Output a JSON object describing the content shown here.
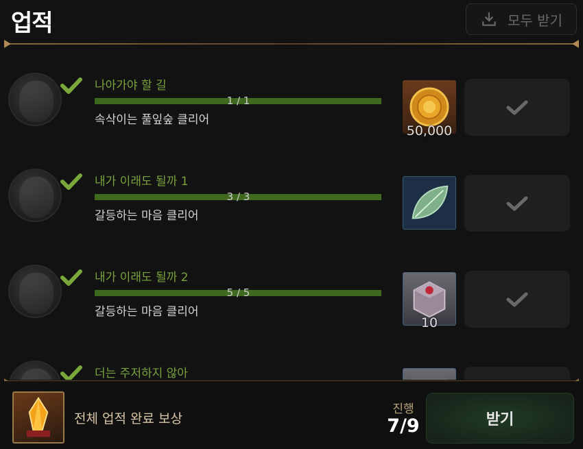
{
  "header": {
    "title": "업적",
    "receive_all_label": "모두 받기"
  },
  "achievements": [
    {
      "title": "나아가야 할 길",
      "progress_text": "1 / 1",
      "progress": 1.0,
      "description": "속삭이는 풀잎숲 클리어",
      "reward_icon": "gold-coin-icon",
      "reward_count": "50,000",
      "status": "claimed"
    },
    {
      "title": "내가 이래도 될까 1",
      "progress_text": "3 / 3",
      "progress": 1.0,
      "description": "갈등하는 마음 클리어",
      "reward_icon": "leaf-icon",
      "reward_count": "",
      "status": "claimed"
    },
    {
      "title": "내가 이래도 될까 2",
      "progress_text": "5 / 5",
      "progress": 1.0,
      "description": "갈등하는 마음 클리어",
      "reward_icon": "treasure-box-icon",
      "reward_count": "10",
      "status": "claimed"
    },
    {
      "title": "더는 주저하지 않아",
      "progress_text": "",
      "progress": 1.0,
      "description": "",
      "reward_icon": "reward-icon",
      "reward_count": "",
      "status": "claimed"
    }
  ],
  "footer": {
    "total_reward_label": "전체 업적 완료 보상",
    "progress_label": "진행",
    "progress_value": "7/9",
    "claim_label": "받기"
  },
  "colors": {
    "accent_green": "#7aa33c",
    "progress_fill": "#3f6a1e",
    "gold_divider": "#8a6a3a"
  }
}
